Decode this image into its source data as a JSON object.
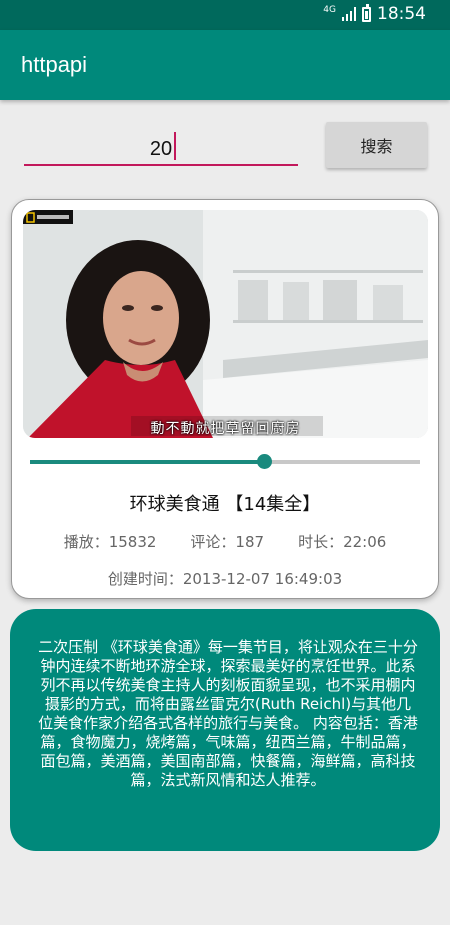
{
  "status_bar": {
    "network_label": "4G",
    "time": "18:54"
  },
  "app_bar": {
    "title": "httpapi"
  },
  "search": {
    "input_value": "20",
    "button_label": "搜索"
  },
  "video_card": {
    "playback_progress": 0.6,
    "subtitle_text": "動不動就把草留回廚房",
    "title": "环球美食通 【14集全】",
    "plays": "播放：15832",
    "comments": "评论：187",
    "duration": "时长：22:06",
    "created": "创建时间：2013-12-07 16:49:03"
  },
  "description": {
    "text": "二次压制 《环球美食通》每一集节目，将让观众在三十分钟内连续不断地环游全球，探索最美好的烹饪世界。此系列不再以传统美食主持人的刻板面貌呈现，也不采用棚内摄影的方式，而将由露丝雷克尔(Ruth Reichl)与其他几位美食作家介绍各式各样的旅行与美食。 内容包括：香港篇，食物魔力，烧烤篇，气味篇，纽西兰篇，牛制品篇，面包篇，美酒篇，美国南部篇，快餐篇，海鲜篇，高科技篇，法式新风情和达人推荐。"
  },
  "colors": {
    "status_bar": "#00695c",
    "app_bar": "#00897b",
    "accent": "#c2185b",
    "slider": "#1a8a7e"
  }
}
